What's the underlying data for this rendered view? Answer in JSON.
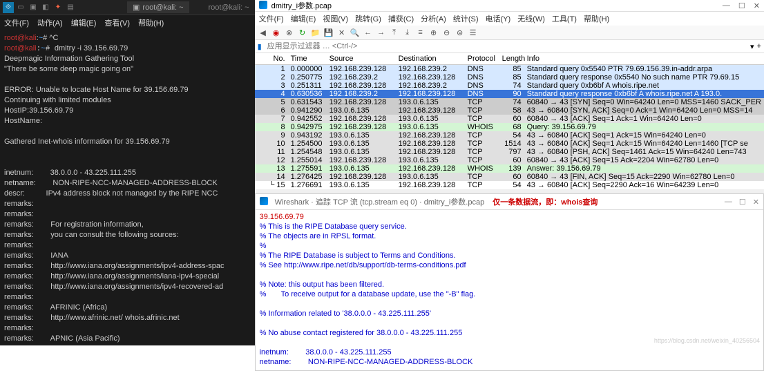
{
  "left": {
    "tab_label": "root@kali: ~",
    "tab_title_right": "root@kali: ~",
    "menu": [
      "文件(F)",
      "动作(A)",
      "编辑(E)",
      "查看(V)",
      "帮助(H)"
    ],
    "prompt1_user": "root@kali",
    "prompt1_sep": ":",
    "prompt1_tilde": "~",
    "prompt1_end": "# ^C",
    "prompt2_user": "root@kali",
    "prompt2_cmd": "dmitry -i 39.156.69.79",
    "out": "Deepmagic Information Gathering Tool\n\"There be some deep magic going on\"\n\nERROR: Unable to locate Host Name for 39.156.69.79\nContinuing with limited modules\nHostIP:39.156.69.79\nHostName:\n\nGathered Inet-whois information for 39.156.69.79\n\n\ninetnum:        38.0.0.0 - 43.225.111.255\nnetname:        NON-RIPE-NCC-MANAGED-ADDRESS-BLOCK\ndescr:          IPv4 address block not managed by the RIPE NCC\nremarks:\nremarks:\nremarks:        For registration information,\nremarks:        you can consult the following sources:\nremarks:\nremarks:        IANA\nremarks:        http://www.iana.org/assignments/ipv4-address-spac\nremarks:        http://www.iana.org/assignments/iana-ipv4-special\nremarks:        http://www.iana.org/assignments/ipv4-recovered-ad\nremarks:\nremarks:        AFRINIC (Africa)\nremarks:        http://www.afrinic.net/ whois.afrinic.net\nremarks:\nremarks:        APNIC (Asia Pacific)"
  },
  "ws": {
    "title": "dmitry_i参数.pcap",
    "menu": [
      "文件(F)",
      "编辑(E)",
      "视图(V)",
      "跳转(G)",
      "捕获(C)",
      "分析(A)",
      "统计(S)",
      "电话(Y)",
      "无线(W)",
      "工具(T)",
      "帮助(H)"
    ],
    "filter_placeholder": "应用显示过滤器 … <Ctrl-/>",
    "headers": {
      "no": "No.",
      "time": "Time",
      "src": "Source",
      "dst": "Destination",
      "proto": "Protocol",
      "len": "Length",
      "info": "Info"
    },
    "rows": [
      {
        "cls": "r-dns",
        "no": "1",
        "time": "0.000000",
        "src": "192.168.239.128",
        "dst": "192.168.239.2",
        "proto": "DNS",
        "len": "85",
        "info": "Standard query 0x5540 PTR 79.69.156.39.in-addr.arpa"
      },
      {
        "cls": "r-dns",
        "no": "2",
        "time": "0.250775",
        "src": "192.168.239.2",
        "dst": "192.168.239.128",
        "proto": "DNS",
        "len": "85",
        "info": "Standard query response 0x5540 No such name PTR 79.69.15"
      },
      {
        "cls": "r-dns",
        "no": "3",
        "time": "0.251311",
        "src": "192.168.239.128",
        "dst": "192.168.239.2",
        "proto": "DNS",
        "len": "74",
        "info": "Standard query 0xb6bf A whois.ripe.net"
      },
      {
        "cls": "r-dns-sel",
        "no": "4",
        "time": "0.630536",
        "src": "192.168.239.2",
        "dst": "192.168.239.128",
        "proto": "DNS",
        "len": "90",
        "info": "Standard query response 0xb6bf A whois.ripe.net A 193.0."
      },
      {
        "cls": "r-tcp-syn",
        "no": "5",
        "time": "0.631543",
        "src": "192.168.239.128",
        "dst": "193.0.6.135",
        "proto": "TCP",
        "len": "74",
        "info": "60840 → 43 [SYN] Seq=0 Win=64240 Len=0 MSS=1460 SACK_PER"
      },
      {
        "cls": "r-tcp-syn",
        "no": "6",
        "time": "0.941290",
        "src": "193.0.6.135",
        "dst": "192.168.239.128",
        "proto": "TCP",
        "len": "58",
        "info": "43 → 60840 [SYN, ACK] Seq=0 Ack=1 Win=64240 Len=0 MSS=14"
      },
      {
        "cls": "r-tcp",
        "no": "7",
        "time": "0.942552",
        "src": "192.168.239.128",
        "dst": "193.0.6.135",
        "proto": "TCP",
        "len": "60",
        "info": "60840 → 43 [ACK] Seq=1 Ack=1 Win=64240 Len=0"
      },
      {
        "cls": "r-whois",
        "no": "8",
        "time": "0.942975",
        "src": "192.168.239.128",
        "dst": "193.0.6.135",
        "proto": "WHOIS",
        "len": "68",
        "info": "Query: 39.156.69.79"
      },
      {
        "cls": "r-tcp",
        "no": "9",
        "time": "0.943192",
        "src": "193.0.6.135",
        "dst": "192.168.239.128",
        "proto": "TCP",
        "len": "54",
        "info": "43 → 60840 [ACK] Seq=1 Ack=15 Win=64240 Len=0"
      },
      {
        "cls": "r-tcp",
        "no": "10",
        "time": "1.254500",
        "src": "193.0.6.135",
        "dst": "192.168.239.128",
        "proto": "TCP",
        "len": "1514",
        "info": "43 → 60840 [ACK] Seq=1 Ack=15 Win=64240 Len=1460 [TCP se"
      },
      {
        "cls": "r-tcp",
        "no": "11",
        "time": "1.254548",
        "src": "193.0.6.135",
        "dst": "192.168.239.128",
        "proto": "TCP",
        "len": "797",
        "info": "43 → 60840 [PSH, ACK] Seq=1461 Ack=15 Win=64240 Len=743"
      },
      {
        "cls": "r-tcp",
        "no": "12",
        "time": "1.255014",
        "src": "192.168.239.128",
        "dst": "193.0.6.135",
        "proto": "TCP",
        "len": "60",
        "info": "60840 → 43 [ACK] Seq=15 Ack=2204 Win=62780 Len=0"
      },
      {
        "cls": "r-whois",
        "no": "13",
        "time": "1.275591",
        "src": "193.0.6.135",
        "dst": "192.168.239.128",
        "proto": "WHOIS",
        "len": "139",
        "info": "Answer: 39.156.69.79"
      },
      {
        "cls": "r-tcp",
        "no": "14",
        "time": "1.276425",
        "src": "192.168.239.128",
        "dst": "193.0.6.135",
        "proto": "TCP",
        "len": "60",
        "info": "60840 → 43 [FIN, ACK] Seq=15 Ack=2290 Win=62780 Len=0"
      },
      {
        "cls": "r-current",
        "no": "15",
        "time": "1.276691",
        "src": "193.0.6.135",
        "dst": "192.168.239.128",
        "proto": "TCP",
        "len": "54",
        "info": "43 → 60840 [ACK] Seq=2290 Ack=16 Win=64239 Len=0"
      }
    ],
    "stream": {
      "title": "Wireshark · 追踪 TCP 流 (tcp.stream eq 0) · dmitry_i参数.pcap",
      "note": "仅一条数据流，即：whois查询",
      "red": "39.156.69.79",
      "body": "% This is the RIPE Database query service.\n% The objects are in RPSL format.\n%\n% The RIPE Database is subject to Terms and Conditions.\n% See http://www.ripe.net/db/support/db-terms-conditions.pdf\n\n% Note: this output has been filtered.\n%       To receive output for a database update, use the \"-B\" flag.\n\n% Information related to '38.0.0.0 - 43.225.111.255'\n\n% No abuse contact registered for 38.0.0.0 - 43.225.111.255\n\ninetnum:        38.0.0.0 - 43.225.111.255\nnetname:        NON-RIPE-NCC-MANAGED-ADDRESS-BLOCK"
    }
  },
  "watermark": "https://blog.csdn.net/weixin_40256504"
}
